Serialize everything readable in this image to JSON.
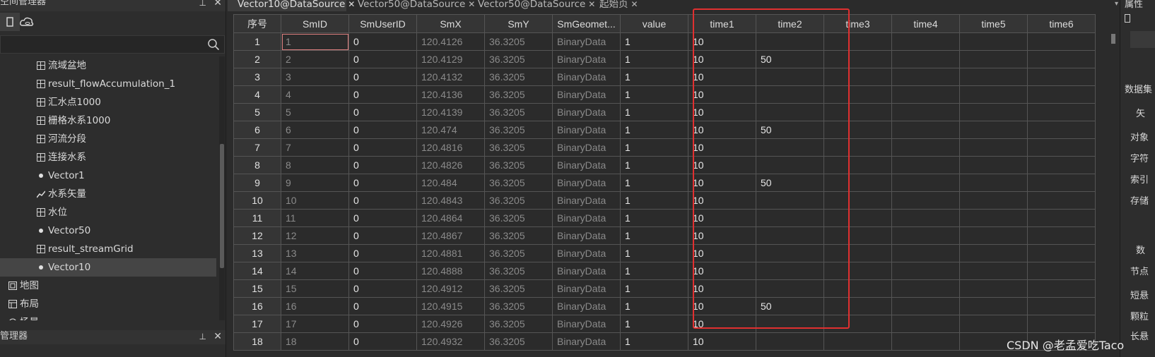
{
  "workspace_panel": {
    "title": "空间管理器",
    "tree": [
      {
        "label": "流域盆地",
        "icon": "grid-dataset-icon"
      },
      {
        "label": "result_flowAccumulation_1",
        "icon": "grid-dataset-icon"
      },
      {
        "label": "汇水点1000",
        "icon": "grid-dataset-icon"
      },
      {
        "label": "栅格水系1000",
        "icon": "grid-dataset-icon"
      },
      {
        "label": "河流分段",
        "icon": "grid-dataset-icon"
      },
      {
        "label": "连接水系",
        "icon": "grid-dataset-icon"
      },
      {
        "label": "Vector1",
        "icon": "point-dataset-icon"
      },
      {
        "label": "水系矢量",
        "icon": "line-dataset-icon"
      },
      {
        "label": "水位",
        "icon": "grid-dataset-icon"
      },
      {
        "label": "Vector50",
        "icon": "point-dataset-icon"
      },
      {
        "label": "result_streamGrid",
        "icon": "grid-dataset-icon"
      },
      {
        "label": "Vector10",
        "icon": "point-dataset-icon",
        "selected": true
      },
      {
        "label": "地图",
        "icon": "map-icon"
      },
      {
        "label": "布局",
        "icon": "layout-icon"
      },
      {
        "label": "场景",
        "icon": "scene-icon"
      }
    ]
  },
  "layer_panel": {
    "title": "管理器"
  },
  "tabs": [
    {
      "label": "Vector10@DataSource",
      "active": true
    },
    {
      "label": "Vector50@DataSource",
      "active": false
    },
    {
      "label": "Vector50@DataSource",
      "active": false
    },
    {
      "label": "起始页",
      "active": false
    }
  ],
  "table": {
    "columns": [
      "序号",
      "SmID",
      "SmUserID",
      "SmX",
      "SmY",
      "SmGeomet...",
      "value",
      "time1",
      "time2",
      "time3",
      "time4",
      "time5",
      "time6"
    ],
    "rows": [
      [
        "1",
        "1",
        "0",
        "120.4126",
        "36.3205",
        "BinaryData",
        "1",
        "10",
        "",
        "",
        "",
        "",
        ""
      ],
      [
        "2",
        "2",
        "0",
        "120.4129",
        "36.3205",
        "BinaryData",
        "1",
        "10",
        "50",
        "",
        "",
        "",
        ""
      ],
      [
        "3",
        "3",
        "0",
        "120.4132",
        "36.3205",
        "BinaryData",
        "1",
        "10",
        "",
        "",
        "",
        "",
        ""
      ],
      [
        "4",
        "4",
        "0",
        "120.4136",
        "36.3205",
        "BinaryData",
        "1",
        "10",
        "",
        "",
        "",
        "",
        ""
      ],
      [
        "5",
        "5",
        "0",
        "120.4139",
        "36.3205",
        "BinaryData",
        "1",
        "10",
        "",
        "",
        "",
        "",
        ""
      ],
      [
        "6",
        "6",
        "0",
        "120.474",
        "36.3205",
        "BinaryData",
        "1",
        "10",
        "50",
        "",
        "",
        "",
        ""
      ],
      [
        "7",
        "7",
        "0",
        "120.4816",
        "36.3205",
        "BinaryData",
        "1",
        "10",
        "",
        "",
        "",
        "",
        ""
      ],
      [
        "8",
        "8",
        "0",
        "120.4826",
        "36.3205",
        "BinaryData",
        "1",
        "10",
        "",
        "",
        "",
        "",
        ""
      ],
      [
        "9",
        "9",
        "0",
        "120.484",
        "36.3205",
        "BinaryData",
        "1",
        "10",
        "50",
        "",
        "",
        "",
        ""
      ],
      [
        "10",
        "10",
        "0",
        "120.4843",
        "36.3205",
        "BinaryData",
        "1",
        "10",
        "",
        "",
        "",
        "",
        ""
      ],
      [
        "11",
        "11",
        "0",
        "120.4864",
        "36.3205",
        "BinaryData",
        "1",
        "10",
        "",
        "",
        "",
        "",
        ""
      ],
      [
        "12",
        "12",
        "0",
        "120.4867",
        "36.3205",
        "BinaryData",
        "1",
        "10",
        "",
        "",
        "",
        "",
        ""
      ],
      [
        "13",
        "13",
        "0",
        "120.4881",
        "36.3205",
        "BinaryData",
        "1",
        "10",
        "",
        "",
        "",
        "",
        ""
      ],
      [
        "14",
        "14",
        "0",
        "120.4888",
        "36.3205",
        "BinaryData",
        "1",
        "10",
        "",
        "",
        "",
        "",
        ""
      ],
      [
        "15",
        "15",
        "0",
        "120.4912",
        "36.3205",
        "BinaryData",
        "1",
        "10",
        "",
        "",
        "",
        "",
        ""
      ],
      [
        "16",
        "16",
        "0",
        "120.4915",
        "36.3205",
        "BinaryData",
        "1",
        "10",
        "50",
        "",
        "",
        "",
        ""
      ],
      [
        "17",
        "17",
        "0",
        "120.4926",
        "36.3205",
        "BinaryData",
        "1",
        "10",
        "",
        "",
        "",
        "",
        ""
      ],
      [
        "18",
        "18",
        "0",
        "120.4932",
        "36.3205",
        "BinaryData",
        "1",
        "10",
        "",
        "",
        "",
        "",
        ""
      ]
    ]
  },
  "properties_panel": {
    "title": "属性",
    "items": [
      "数据集",
      "矢",
      "对象",
      "字符",
      "索引",
      "存储",
      "数",
      "节点",
      "短悬",
      "颗粒",
      "长悬"
    ]
  },
  "watermark": "CSDN @老孟爱吃Taco",
  "colors": {
    "highlight_box": "#e03030",
    "selected_row": "#454545"
  }
}
